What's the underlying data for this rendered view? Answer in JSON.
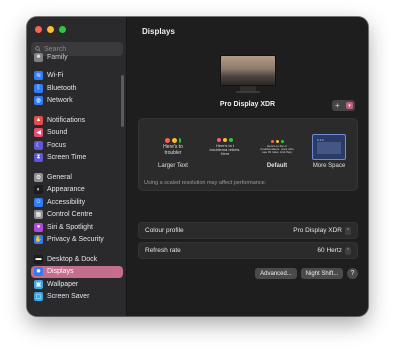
{
  "window": {
    "traffic_colors": [
      "#ff5f57",
      "#febc2e",
      "#28c840"
    ]
  },
  "sidebar": {
    "search_placeholder": "Search",
    "partial_item": {
      "label": "Family",
      "icon": "family-icon",
      "color": "#8e8e93"
    },
    "groups": [
      [
        {
          "label": "Wi-Fi",
          "icon": "wifi-icon",
          "color": "#2f7cf6"
        },
        {
          "label": "Bluetooth",
          "icon": "bluetooth-icon",
          "color": "#2f7cf6"
        },
        {
          "label": "Network",
          "icon": "globe-icon",
          "color": "#2f7cf6"
        }
      ],
      [
        {
          "label": "Notifications",
          "icon": "bell-icon",
          "color": "#e74c4c"
        },
        {
          "label": "Sound",
          "icon": "speaker-icon",
          "color": "#e74c6f"
        },
        {
          "label": "Focus",
          "icon": "moon-icon",
          "color": "#5e56d6"
        },
        {
          "label": "Screen Time",
          "icon": "hourglass-icon",
          "color": "#5e56d6"
        }
      ],
      [
        {
          "label": "General",
          "icon": "gear-icon",
          "color": "#8e8e93"
        },
        {
          "label": "Appearance",
          "icon": "appearance-icon",
          "color": "#1c1c1e"
        },
        {
          "label": "Accessibility",
          "icon": "accessibility-icon",
          "color": "#2f7cf6"
        },
        {
          "label": "Control Centre",
          "icon": "control-centre-icon",
          "color": "#8e8e93"
        },
        {
          "label": "Siri & Spotlight",
          "icon": "siri-icon",
          "color": "#b04ad8"
        },
        {
          "label": "Privacy & Security",
          "icon": "hand-icon",
          "color": "#2f7cf6"
        }
      ],
      [
        {
          "label": "Desktop & Dock",
          "icon": "dock-icon",
          "color": "#1c1c1e"
        },
        {
          "label": "Displays",
          "icon": "display-icon",
          "color": "#2f7cf6",
          "selected": true
        },
        {
          "label": "Wallpaper",
          "icon": "wallpaper-icon",
          "color": "#3aa7e8"
        },
        {
          "label": "Screen Saver",
          "icon": "screen-saver-icon",
          "color": "#3aa7e8"
        }
      ]
    ],
    "selected_color": "#c56d8c"
  },
  "main": {
    "title": "Displays",
    "display_name": "Pro Display XDR",
    "add_button": "+",
    "resolution": {
      "options": [
        {
          "label": "Larger Text",
          "thumb_text": "Here's to troubler",
          "selected": false
        },
        {
          "label": "",
          "thumb_text": "Here's to t troublema rebels. Here",
          "selected": false
        },
        {
          "label": "Default",
          "thumb_text": "Here's to the cr troublemakers. ones who see thi rules. And they",
          "selected": false
        },
        {
          "label": "More Space",
          "thumb_text": "",
          "selected": true
        }
      ],
      "note": "Using a scaled resolution may affect performance."
    },
    "colour_profile": {
      "label": "Colour profile",
      "value": "Pro Display XDR"
    },
    "refresh_rate": {
      "label": "Refresh rate",
      "value": "60 Hertz"
    },
    "advanced_button": "Advanced...",
    "night_shift_button": "Night Shift...",
    "help_button": "?"
  }
}
